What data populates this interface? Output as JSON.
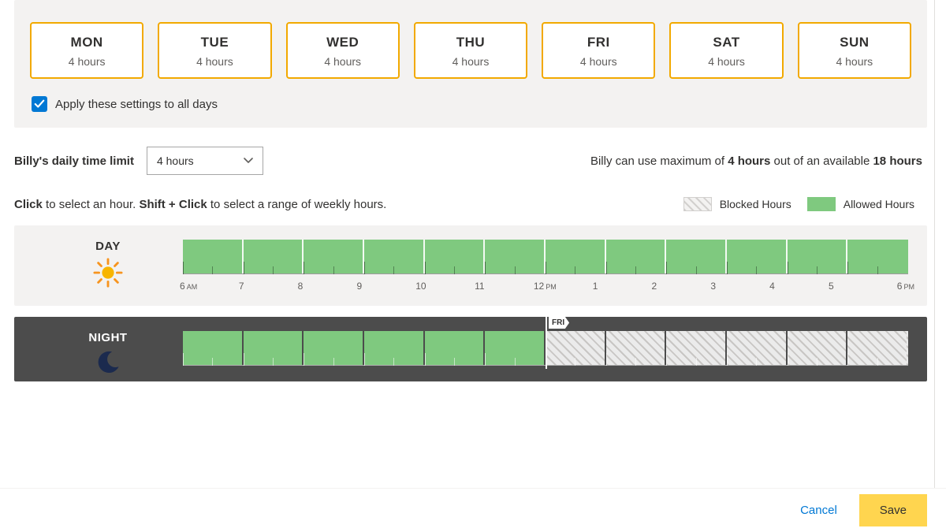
{
  "colors": {
    "accent": "#f2a900",
    "allowed": "#7fc97f",
    "link": "#0078d4",
    "save": "#ffd54f"
  },
  "days": {
    "items": [
      {
        "abbr": "MON",
        "hours": "4 hours"
      },
      {
        "abbr": "TUE",
        "hours": "4 hours"
      },
      {
        "abbr": "WED",
        "hours": "4 hours"
      },
      {
        "abbr": "THU",
        "hours": "4 hours"
      },
      {
        "abbr": "FRI",
        "hours": "4 hours"
      },
      {
        "abbr": "SAT",
        "hours": "4 hours"
      },
      {
        "abbr": "SUN",
        "hours": "4 hours"
      }
    ],
    "apply_all_label": "Apply these settings to all days",
    "apply_all_checked": true
  },
  "limit": {
    "label": "Billy's daily time limit",
    "selected": "4 hours",
    "summary_prefix": "Billy can use maximum of ",
    "summary_hours": "4 hours",
    "summary_mid": " out of an available ",
    "summary_avail": "18 hours"
  },
  "instructions": {
    "click_strong": "Click",
    "click_rest": " to select an hour. ",
    "shift_strong": "Shift + Click",
    "shift_rest": " to select a range of weekly hours."
  },
  "legend": {
    "blocked": "Blocked Hours",
    "allowed": "Allowed Hours"
  },
  "tracks": {
    "day": {
      "title": "DAY",
      "hours": [
        "6 AM",
        "7",
        "8",
        "9",
        "10",
        "11",
        "12 PM",
        "1",
        "2",
        "3",
        "4",
        "5",
        "6 PM"
      ],
      "cells_allowed": [
        true,
        true,
        true,
        true,
        true,
        true,
        true,
        true,
        true,
        true,
        true,
        true
      ]
    },
    "night": {
      "title": "NIGHT",
      "marker_label": "FRI",
      "marker_index": 6,
      "cells_allowed": [
        true,
        true,
        true,
        true,
        true,
        true,
        false,
        false,
        false,
        false,
        false,
        false
      ]
    }
  },
  "footer": {
    "cancel": "Cancel",
    "save": "Save"
  }
}
